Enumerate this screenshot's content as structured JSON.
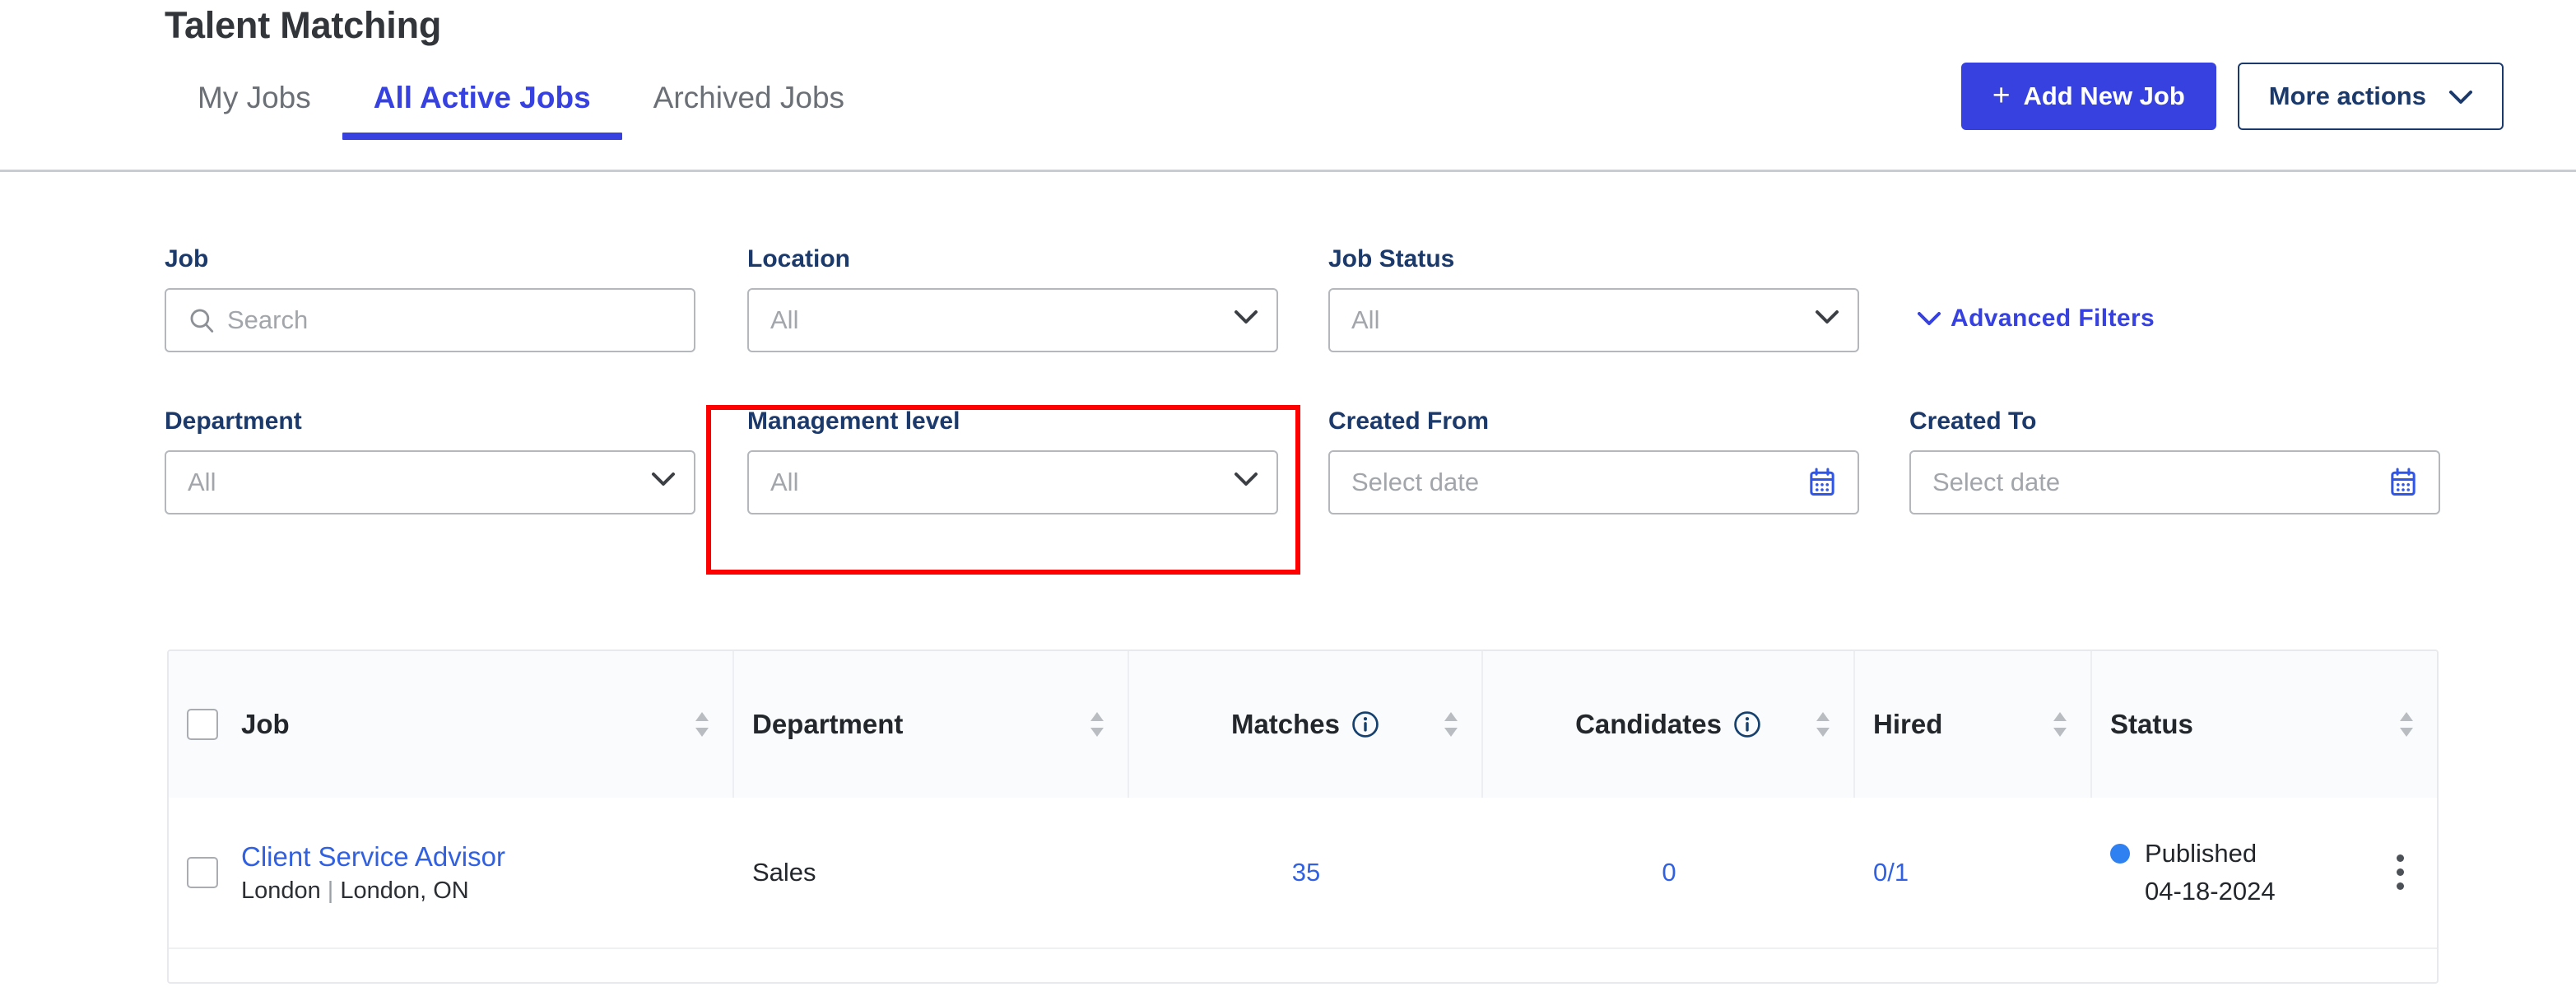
{
  "header": {
    "title": "Talent Matching",
    "tabs": [
      {
        "label": "My Jobs",
        "active": false
      },
      {
        "label": "All Active Jobs",
        "active": true
      },
      {
        "label": "Archived Jobs",
        "active": false
      }
    ],
    "add_new_job_label": "Add New Job",
    "add_new_job_plus": "+",
    "more_actions_label": "More actions"
  },
  "filters": {
    "advanced_filters_label": "Advanced Filters",
    "row1": [
      {
        "label": "Job",
        "placeholder": "Search",
        "type": "search"
      },
      {
        "label": "Location",
        "placeholder": "All",
        "type": "select"
      },
      {
        "label": "Job Status",
        "placeholder": "All",
        "type": "select"
      }
    ],
    "row2": [
      {
        "label": "Department",
        "placeholder": "All",
        "type": "select"
      },
      {
        "label": "Management level",
        "placeholder": "All",
        "type": "select",
        "highlighted": true
      },
      {
        "label": "Created From",
        "placeholder": "Select date",
        "type": "date"
      },
      {
        "label": "Created To",
        "placeholder": "Select date",
        "type": "date"
      }
    ]
  },
  "table": {
    "columns": [
      {
        "label": "Job",
        "sortable": true,
        "has_checkbox": true,
        "info": false
      },
      {
        "label": "Department",
        "sortable": true,
        "info": false
      },
      {
        "label": "Matches",
        "sortable": true,
        "info": true
      },
      {
        "label": "Candidates",
        "sortable": true,
        "info": true
      },
      {
        "label": "Hired",
        "sortable": true,
        "info": false
      },
      {
        "label": "Status",
        "sortable": true,
        "info": false
      }
    ],
    "rows": [
      {
        "job_title": "Client Service Advisor",
        "job_location_primary": "London",
        "job_location_separator": "|",
        "job_location_secondary": "London, ON",
        "department": "Sales",
        "matches": "35",
        "candidates": "0",
        "hired": "0/1",
        "status_label": "Published",
        "status_date": "04-18-2024"
      }
    ]
  },
  "colors": {
    "accent_blue": "#3641e0",
    "link_blue": "#3161e0",
    "navy": "#1b3a6b",
    "highlight_red": "#ff0000",
    "status_dot": "#2f80f0"
  }
}
